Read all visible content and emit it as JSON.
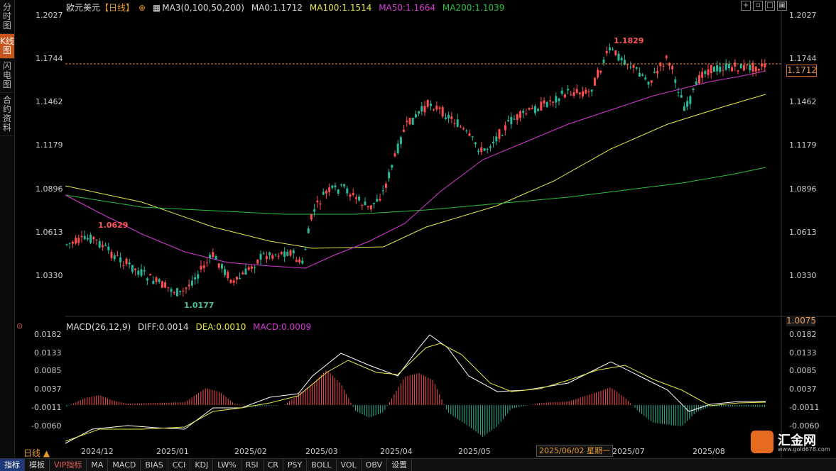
{
  "sidebar": {
    "tabs": [
      "分时图",
      "K线图",
      "闪电图",
      "合约资料"
    ],
    "active_index": 1
  },
  "header": {
    "symbol": "欧元美元",
    "period_tag": "【日线】",
    "ma_label": "MA3(0,100,50,200)",
    "ma0": "MA0:1.1712",
    "ma100": "MA100:1.1514",
    "ma50": "MA50:1.1664",
    "ma200": "MA200:1.1039"
  },
  "macd_header": {
    "label": "MACD(26,12,9)",
    "diff": "DIFF:0.0014",
    "dea": "DEA:0.0010",
    "macd": "MACD:0.0009"
  },
  "price_axis": [
    "1.2027",
    "1.1744",
    "1.1462",
    "1.1179",
    "1.0896",
    "1.0613",
    "1.0330"
  ],
  "macd_axis": [
    "0.0182",
    "0.0133",
    "0.0085",
    "0.0037",
    "-0.0011",
    "-0.0060"
  ],
  "current_price": "1.1712",
  "crosshair_value": "1.0075",
  "annotations": {
    "high": "1.1829",
    "low": "1.0177",
    "left_high": "1.0629"
  },
  "date_axis": [
    "2024/12",
    "2025/01",
    "2025/02",
    "2025/03",
    "2025/04",
    "2025/05",
    "2025/07",
    "2025/08"
  ],
  "date_tooltip": "2025/06/02 星期一",
  "period_selector": "日线 ▲",
  "bottom_bar": [
    "指标",
    "模板",
    "VIP指标",
    "MA",
    "MACD",
    "BIAS",
    "CCI",
    "KDJ",
    "LW%",
    "RSI",
    "CR",
    "PSY",
    "BOLL",
    "VOL",
    "OBV",
    "设置"
  ],
  "logo": {
    "name": "汇金网",
    "url": "www.gold678.com"
  },
  "colors": {
    "up": "#ff4d4d",
    "down": "#2bb89a",
    "ma100": "#e8e84a",
    "ma50": "#d43ad4",
    "ma200": "#2fbf3f",
    "accent": "#e89a2a"
  }
}
